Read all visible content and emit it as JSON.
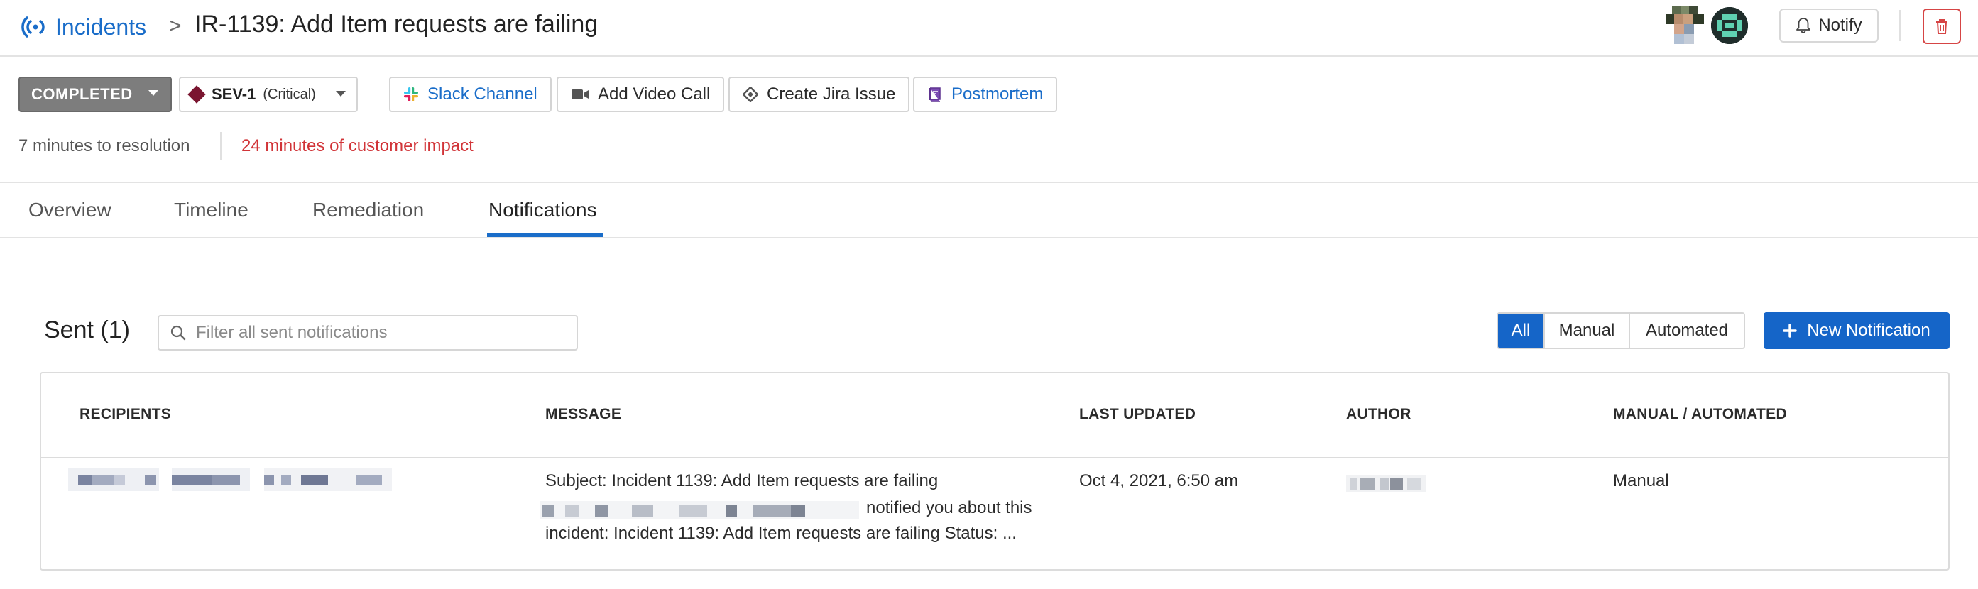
{
  "header": {
    "brand": "Incidents",
    "separator": ">",
    "title": "IR-1139:  Add Item requests are failing",
    "notify_label": "Notify"
  },
  "toolbar": {
    "status": "COMPLETED",
    "severity": "SEV-1",
    "severity_desc": "(Critical)",
    "slack": "Slack Channel",
    "video": "Add Video Call",
    "jira": "Create Jira Issue",
    "postmortem": "Postmortem"
  },
  "meta": {
    "resolution": "7 minutes to resolution",
    "impact": "24 minutes of customer impact"
  },
  "tabs": [
    {
      "label": "Overview"
    },
    {
      "label": "Timeline"
    },
    {
      "label": "Remediation"
    },
    {
      "label": "Notifications"
    }
  ],
  "sent": {
    "title": "Sent (1)",
    "search_placeholder": "Filter all sent notifications",
    "search_value": "",
    "filters": [
      "All",
      "Manual",
      "Automated"
    ],
    "new_button": "New Notification"
  },
  "table": {
    "headers": [
      "RECIPIENTS",
      "MESSAGE",
      "LAST UPDATED",
      "AUTHOR",
      "MANUAL / AUTOMATED"
    ],
    "rows": [
      {
        "subject": "Subject: Incident 1139: Add Item requests are failing",
        "message_line2": "notified you about this",
        "message_line3": "incident: Incident 1139: Add Item requests are failing Status: ...",
        "updated": "Oct 4, 2021, 6:50 am",
        "type": "Manual"
      }
    ]
  },
  "colors": {
    "brand_blue": "#1a6dc9",
    "primary_button": "#1565c8",
    "status_gray": "#7d7d7d",
    "sev1": "#7a1530",
    "impact_red": "#d13438",
    "delete_red": "#d64545"
  }
}
